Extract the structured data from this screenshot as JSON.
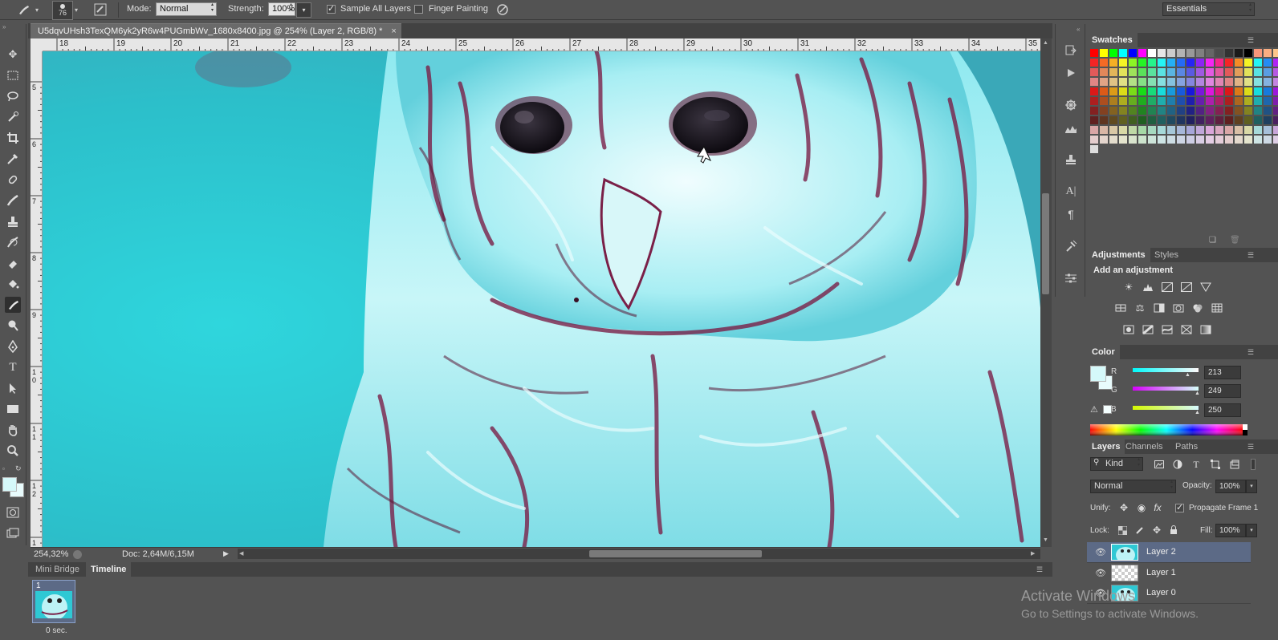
{
  "options_bar": {
    "brush_size": "76",
    "mode_label": "Mode:",
    "mode_value": "Normal",
    "strength_label": "Strength:",
    "strength_value": "100%",
    "sample_all_layers": "Sample All Layers",
    "finger_painting": "Finger Painting",
    "workspace": "Essentials"
  },
  "document": {
    "tab_title": "U5dqvUHsh3TexQM6yk2yR6w4PUGmbWv_1680x8400.jpg @ 254% (Layer 2, RGB/8) *",
    "close_glyph": "×",
    "ruler_h": [
      "18",
      "19",
      "20",
      "21",
      "22",
      "23",
      "24",
      "25",
      "26",
      "27",
      "28",
      "29",
      "30",
      "31",
      "32",
      "33",
      "34",
      "35"
    ],
    "ruler_v": [
      "5",
      "6",
      "7",
      "8",
      "9",
      "1\n0",
      "1\n1",
      "1\n2",
      "1"
    ]
  },
  "status": {
    "zoom": "254,32%",
    "doc_size": "Doc: 2,64M/6,15M"
  },
  "bottom_panel": {
    "tabs": [
      "Mini Bridge",
      "Timeline"
    ],
    "frame_number": "1",
    "frame_delay": "0 sec."
  },
  "swatches_panel": {
    "title": "Swatches"
  },
  "adjustments_panel": {
    "tabs": [
      "Adjustments",
      "Styles"
    ],
    "hint": "Add an adjustment"
  },
  "color_panel": {
    "title": "Color",
    "r_label": "R",
    "r_value": "213",
    "g_label": "G",
    "g_value": "249",
    "b_label": "B",
    "b_value": "250",
    "foreground": "#d5f9fa"
  },
  "layers_panel": {
    "tabs": [
      "Layers",
      "Channels",
      "Paths"
    ],
    "filter_kind": "Kind",
    "blend_mode": "Normal",
    "opacity_label": "Opacity:",
    "opacity_value": "100%",
    "unify_label": "Unify:",
    "propagate_label": "Propagate Frame 1",
    "lock_label": "Lock:",
    "fill_label": "Fill:",
    "fill_value": "100%",
    "layers": [
      {
        "name": "Layer 2",
        "selected": true
      },
      {
        "name": "Layer 1",
        "selected": false
      },
      {
        "name": "Layer 0",
        "selected": false
      }
    ]
  },
  "watermark": {
    "line1": "Activate Windows",
    "line2": "Go to Settings to activate Windows."
  },
  "colors": {
    "canvas_base": "#2ec8d4",
    "feather_dark": "#6a1a40",
    "feather_light": "#e8fbfc",
    "selected_layer": "#5c6a86"
  }
}
